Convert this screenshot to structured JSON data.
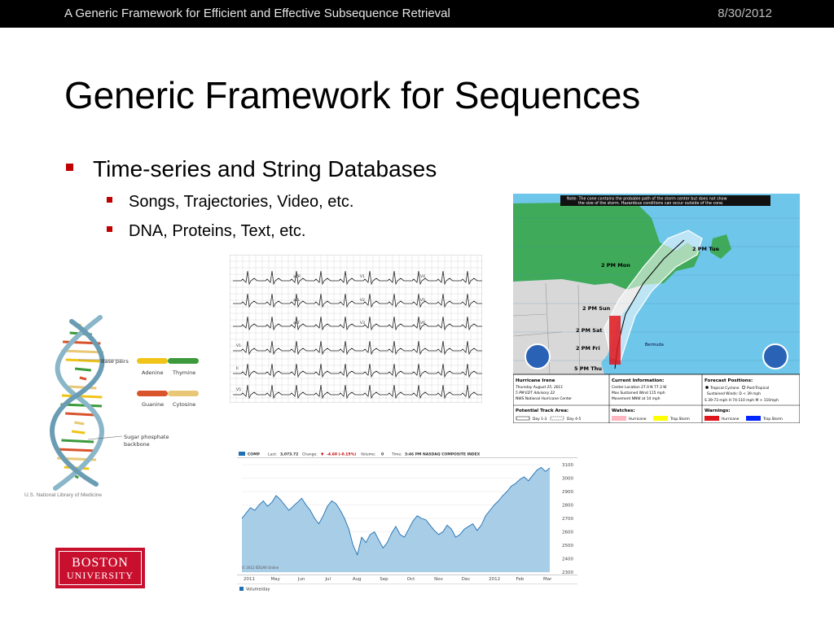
{
  "header": {
    "presentation_title": "A Generic Framework for Efficient and Effective Subsequence Retrieval",
    "date": "8/30/2012"
  },
  "slide": {
    "title": "Generic Framework for Sequences",
    "bullets": [
      {
        "text": "Time-series and String Databases",
        "sub": [
          "Songs, Trajectories, Video, etc.",
          "DNA, Proteins, Text, etc."
        ]
      }
    ]
  },
  "dna_figure": {
    "labels": {
      "base_pairs": "Base pairs",
      "adenine": "Adenine",
      "thymine": "Thymine",
      "guanine": "Guanine",
      "cytosine": "Cytosine",
      "backbone_1": "Sugar phosphate",
      "backbone_2": "backbone"
    },
    "credit": "U.S. National Library of Medicine",
    "colors": {
      "adenine": "#f0c419",
      "thymine": "#3c9a3c",
      "guanine": "#d9532c",
      "cytosine": "#e8c877",
      "backbone": "#8ab6c9"
    }
  },
  "ecg_figure": {
    "leads": [
      "aVR",
      "V1",
      "V4",
      "aVL",
      "V2",
      "V5",
      "aVF",
      "V3",
      "V6",
      "V1",
      "II",
      "V5"
    ]
  },
  "hurricane_map": {
    "note_1": "Note: The cone contains the probable path of the storm center but does not show",
    "note_2": "the size of the storm. Hazardous conditions can occur outside of the cone.",
    "track_labels": [
      "2 PM Tue",
      "2 PM Mon",
      "2 PM Sun",
      "2 PM Sat",
      "2 PM Fri",
      "5 PM Thu"
    ],
    "place_label": "Bermuda",
    "info": {
      "storm": "Hurricane Irene",
      "advisory_1": "Thursday August 25, 2011",
      "advisory_2": "5 PM EDT Advisory 22",
      "advisory_3": "NWS National Hurricane Center",
      "current_header": "Current Information:",
      "current_1": "Center Location 27.0 N 77.3 W",
      "current_2": "Max Sustained Wind 115 mph",
      "current_3": "Movement NNW at 14 mph",
      "forecast_header": "Forecast Positions:",
      "forecast_1": "Tropical Cyclone",
      "forecast_2": "Post-Tropical",
      "forecast_3": "Sustained Winds: D < 39 mph",
      "forecast_4": "S 39-73 mph H 74-110 mph M > 110mph",
      "track_area": "Potential Track Area:",
      "day13": "Day 1-3",
      "day45": "Day 4-5",
      "watches": "Watches:",
      "warnings": "Warnings:",
      "hurricane": "Hurricane",
      "trop_storm": "Trop.Storm"
    },
    "colors": {
      "land": "#3faa5a",
      "water": "#6ec6ea",
      "us_land": "#d8d8d8",
      "cone": "#ffffff",
      "warning": "#e0151b"
    }
  },
  "stock_chart": {
    "symbol": "COMP",
    "last_label": "Last:",
    "last": "3,073.72",
    "change_label": "Change:",
    "change": "-4.60 (-0.15%)",
    "volume_label": "Volume:",
    "volume": "0",
    "time_label": "Time:",
    "time": "3:46 PM",
    "index_name": "NASDAQ COMPOSITE INDEX",
    "source": "© 2012 EDGAR Online",
    "volume_legend": "Volume/day",
    "y_ticks": [
      "3100",
      "3000",
      "2900",
      "2800",
      "2700",
      "2600",
      "2500",
      "2400",
      "2300"
    ],
    "x_ticks": [
      "2011",
      "May",
      "Jun",
      "Jul",
      "Aug",
      "Sep",
      "Oct",
      "Nov",
      "Dec",
      "2012",
      "Feb",
      "Mar"
    ],
    "colors": {
      "fill": "#a8cde6",
      "line": "#1f6fb2"
    }
  },
  "logo": {
    "line1": "BOSTON",
    "line2": "UNIVERSITY",
    "color": "#c8102e"
  }
}
